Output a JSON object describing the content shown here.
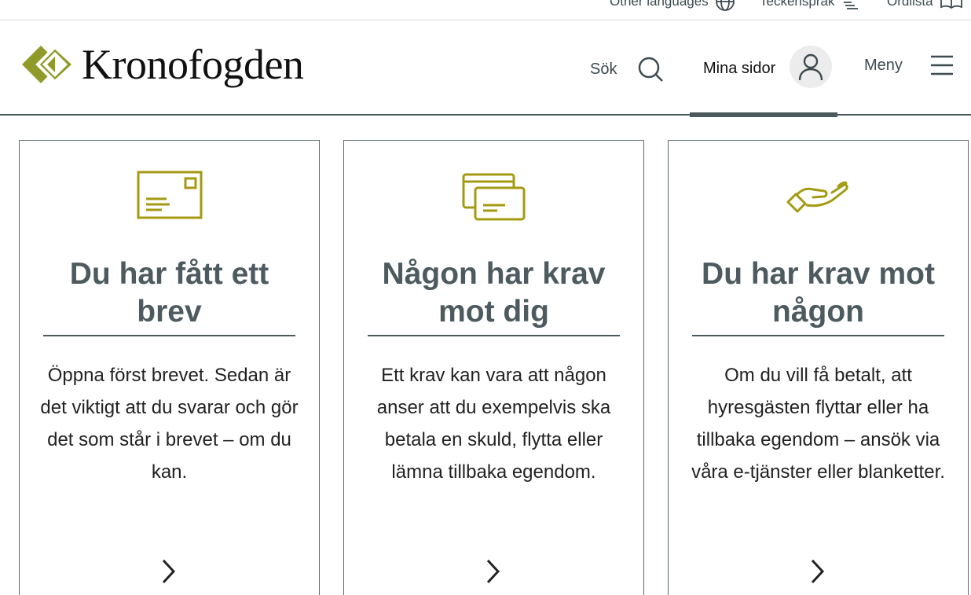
{
  "utility": {
    "other_languages": "Other languages",
    "sign_language": "Teckenspråk",
    "glossary": "Ordlista"
  },
  "header": {
    "logo_text": "Kronofogden",
    "search_label": "Sök",
    "my_pages_label": "Mina sidor",
    "menu_label": "Meny"
  },
  "cards": [
    {
      "icon": "envelope-icon",
      "title": "Du har fått ett brev",
      "body": "Öppna först brevet. Sedan är det viktigt att du svarar och gör det som står i brevet – om du kan."
    },
    {
      "icon": "letters-icon",
      "title": "Någon har krav mot dig",
      "body": "Ett krav kan vara att någon anser att du exempelvis ska betala en skuld, flytta eller lämna tillbaka egendom."
    },
    {
      "icon": "hand-icon",
      "title": "Du har krav mot någon",
      "body": "Om du vill få betalt, att hyresgästen flyttar eller ha tillbaka egendom – ansök via våra e-tjänster eller blanketter."
    }
  ],
  "colors": {
    "brand_green": "#8f9a2a",
    "icon_olive": "#a49a12",
    "slate": "#4d5b60"
  }
}
